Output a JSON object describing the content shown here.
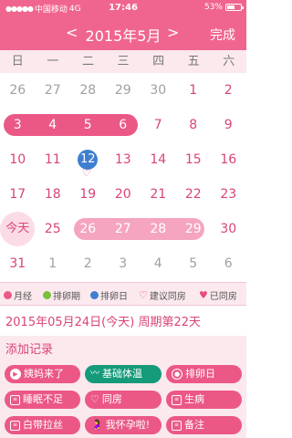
{
  "status": {
    "carrier": "中国移动",
    "network": "4G",
    "time": "17:46",
    "battery": "53%"
  },
  "nav": {
    "prev": "<",
    "title": "2015年5月",
    "next": ">",
    "done": "完成"
  },
  "weekdays": [
    "日",
    "一",
    "二",
    "三",
    "四",
    "五",
    "六"
  ],
  "calendar": {
    "rows": [
      [
        "26",
        "27",
        "28",
        "29",
        "30",
        "1",
        "2"
      ],
      [
        "3",
        "4",
        "5",
        "6",
        "7",
        "8",
        "9"
      ],
      [
        "10",
        "11",
        "12",
        "13",
        "14",
        "15",
        "16"
      ],
      [
        "17",
        "18",
        "19",
        "20",
        "21",
        "22",
        "23"
      ],
      [
        "今天",
        "25",
        "26",
        "27",
        "28",
        "29",
        "30"
      ],
      [
        "31",
        "1",
        "2",
        "3",
        "4",
        "5",
        "6"
      ]
    ]
  },
  "legend": {
    "period": "月经",
    "fertile": "排卵期",
    "ovulation": "排卵日",
    "suggest": "建议同房",
    "done": "已同房"
  },
  "info": "2015年05月24日(今天)  周期第22天",
  "records": {
    "title": "添加记录",
    "buttons": [
      {
        "label": "姨妈来了",
        "icon": "play-icon"
      },
      {
        "label": "基础体温",
        "icon": "chart-icon"
      },
      {
        "label": "排卵日",
        "icon": "target-icon"
      },
      {
        "label": "睡眠不足",
        "icon": "note-icon"
      },
      {
        "label": "同房",
        "icon": "heart-icon"
      },
      {
        "label": "生病",
        "icon": "note-icon"
      },
      {
        "label": "白带拉丝",
        "icon": "note-icon"
      },
      {
        "label": "我怀孕啦!",
        "icon": "pregnant-icon"
      },
      {
        "label": "备注",
        "icon": "note-icon"
      }
    ]
  },
  "colors": {
    "accent": "#f0658e",
    "period": "#eb5886",
    "fertile": "#7bbf3a",
    "ovulation": "#3f7fd0",
    "green_button": "#159a7a"
  }
}
